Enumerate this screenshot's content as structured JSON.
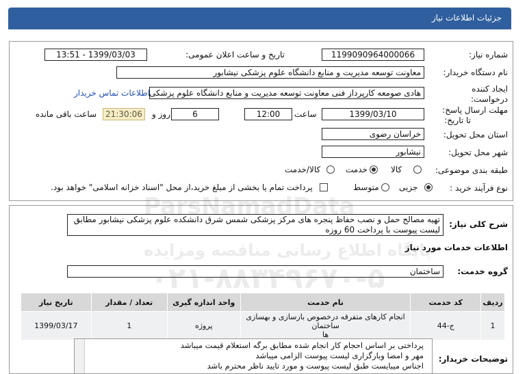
{
  "header": {
    "title": "جزئیات اطلاعات نیاز"
  },
  "fields": {
    "need_number_label": "شماره نیاز:",
    "need_number": "1199090964000066",
    "announce_label": "تاریخ و ساعت اعلان عمومی:",
    "announce_value": "1399/03/03 - 13:51",
    "buyer_label": "نام دستگاه خریدار:",
    "buyer_value": "معاونت توسعه مدیریت و منابع دانشگاه علوم پزشکی نیشابور",
    "creator_label": "ایجاد کننده درخواست:",
    "creator_value": "هادی صومعه کارپرداز فنی معاونت توسعه مدیریت و منابع دانشگاه علوم پزشکی",
    "contact_link": "اطلاعات تماس خریدار",
    "deadline_label": "مهلت ارسال پاسخ:",
    "deadline_to": "تا تاریخ:",
    "deadline_date": "1399/03/10",
    "hour_label": "ساعت",
    "deadline_time": "12:00",
    "days_value": "6",
    "days_label": "روز و",
    "remaining_time": "21:30:06",
    "remaining_label": "ساعت باقی مانده",
    "province_label": "استان محل تحویل:",
    "province_value": "خراسان رضوی",
    "city_label": "شهر محل تحویل:",
    "city_value": "نیشابور",
    "category_label": "طبقه بندی موضوعی:",
    "category_options": [
      "کالا",
      "خدمت",
      "کالا/خدمت"
    ],
    "category_selected": "خدمت",
    "process_label": "نوع فرآیند خرید :",
    "process_options": [
      "جزیی",
      "متوسط"
    ],
    "process_selected": "جزیی",
    "payment_note": "پرداخت تمام یا بخشی از مبلغ خرید،از محل \"اسناد خزانه اسلامی\" خواهد بود."
  },
  "summary": {
    "label": "شرح کلی نیاز:",
    "text_line1": "تهیه  مصالح حمل و نصب حفاظ پنجره های مرکز پزشکی شمس شرق دانشکده علوم پزشکی نیشابور مطابق",
    "text_line2": "لیست پیوست با پرداخت 60 روزه"
  },
  "services": {
    "section_title": "اطلاعات خدمات مورد نیاز",
    "group_label": "گروه خدمت:",
    "group_value": "ساختمان",
    "columns": [
      "ردیف",
      "کد خدمت",
      "نام خدمت",
      "واحد اندازه گیری",
      "تعداد / مقدار",
      "تاریخ نیاز"
    ],
    "rows": [
      {
        "index": "1",
        "code": "ج-44",
        "name_line1": "انجام کارهای متفرقه درخصوص بازسازی و بهسازی ساختمان",
        "name_line2": "ها",
        "unit": "پروژه",
        "qty": "1",
        "date": "1399/03/17"
      }
    ]
  },
  "buyer_notes": {
    "label": "توضیحات خریدار:",
    "lines": [
      "پرداختی بر اساس احجام کار انجام شده مطابق برگه استعلام قیمت میباشد",
      "مهر و امضا وبارگزاری لیست پیوست الزامی میباشد",
      "اجناس میبایست طبق لیست پیوست و مورد تایید ناظر محترم باشد"
    ]
  },
  "watermark": {
    "brand": "ParsNamadData",
    "line1": "پایگاه اطلاع رسانی مناقصه ومزایده",
    "phone": "۰۲۱-۸۸۳۴۹۶۷۰-۵"
  },
  "colors": {
    "header": "#2f5f9e",
    "link": "#1f4fb5",
    "timer_bg": "#f6edc7"
  }
}
